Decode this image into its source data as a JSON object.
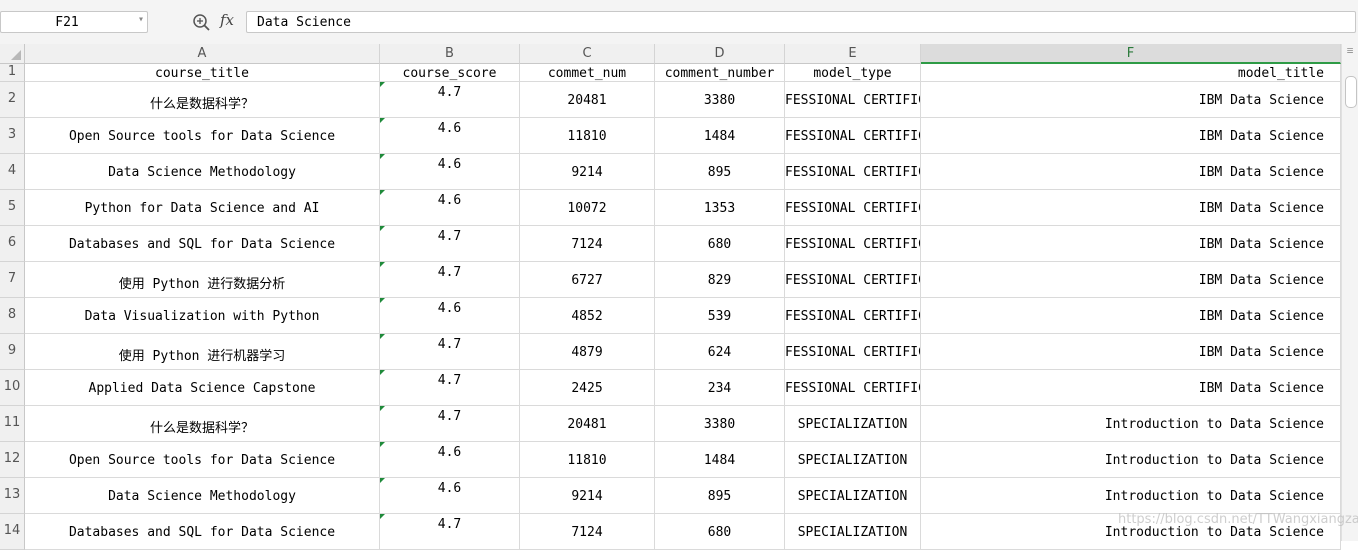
{
  "formula_bar": {
    "name_box": "F21",
    "zoom_icon": "zoom-in-icon",
    "fx_label": "fx",
    "formula_value": "Data Science"
  },
  "columns": [
    {
      "letter": "A",
      "active": false
    },
    {
      "letter": "B",
      "active": false
    },
    {
      "letter": "C",
      "active": false
    },
    {
      "letter": "D",
      "active": false
    },
    {
      "letter": "E",
      "active": false
    },
    {
      "letter": "F",
      "active": true
    }
  ],
  "header_row": {
    "number": "1",
    "cells": [
      "course_title",
      "course_score",
      "commet_num",
      "comment_number",
      "model_type",
      "model_title"
    ]
  },
  "rows": [
    {
      "number": "2",
      "cells": [
        "什么是数据科学？",
        "4.7",
        "20481",
        "3380",
        "FESSIONAL CERTIFIC",
        "IBM Data Science"
      ]
    },
    {
      "number": "3",
      "cells": [
        "Open Source tools for Data Science",
        "4.6",
        "11810",
        "1484",
        "FESSIONAL CERTIFIC",
        "IBM Data Science"
      ]
    },
    {
      "number": "4",
      "cells": [
        "Data Science Methodology",
        "4.6",
        "9214",
        "895",
        "FESSIONAL CERTIFIC",
        "IBM Data Science"
      ]
    },
    {
      "number": "5",
      "cells": [
        "Python for Data Science and AI",
        "4.6",
        "10072",
        "1353",
        "FESSIONAL CERTIFIC",
        "IBM Data Science"
      ]
    },
    {
      "number": "6",
      "cells": [
        "Databases and SQL for Data Science",
        "4.7",
        "7124",
        "680",
        "FESSIONAL CERTIFIC",
        "IBM Data Science"
      ]
    },
    {
      "number": "7",
      "cells": [
        "使用 Python 进行数据分析",
        "4.7",
        "6727",
        "829",
        "FESSIONAL CERTIFIC",
        "IBM Data Science"
      ]
    },
    {
      "number": "8",
      "cells": [
        "Data Visualization with Python",
        "4.6",
        "4852",
        "539",
        "FESSIONAL CERTIFIC",
        "IBM Data Science"
      ]
    },
    {
      "number": "9",
      "cells": [
        "使用 Python 进行机器学习",
        "4.7",
        "4879",
        "624",
        "FESSIONAL CERTIFIC",
        "IBM Data Science"
      ]
    },
    {
      "number": "10",
      "cells": [
        "Applied Data Science Capstone",
        "4.7",
        "2425",
        "234",
        "FESSIONAL CERTIFIC",
        "IBM Data Science"
      ]
    },
    {
      "number": "11",
      "cells": [
        "什么是数据科学？",
        "4.7",
        "20481",
        "3380",
        "SPECIALIZATION",
        "Introduction to Data Science"
      ]
    },
    {
      "number": "12",
      "cells": [
        "Open Source tools for Data Science",
        "4.6",
        "11810",
        "1484",
        "SPECIALIZATION",
        "Introduction to Data Science"
      ]
    },
    {
      "number": "13",
      "cells": [
        "Data Science Methodology",
        "4.6",
        "9214",
        "895",
        "SPECIALIZATION",
        "Introduction to Data Science"
      ]
    },
    {
      "number": "14",
      "cells": [
        "Databases and SQL for Data Science",
        "4.7",
        "7124",
        "680",
        "SPECIALIZATION",
        "Introduction to Data Science"
      ]
    }
  ],
  "watermark": "https://blog.csdn.net/TTWangxiangzai",
  "colors": {
    "selection_accent": "#2e9b46",
    "number_as_text_flag": "#1f8a3a"
  }
}
